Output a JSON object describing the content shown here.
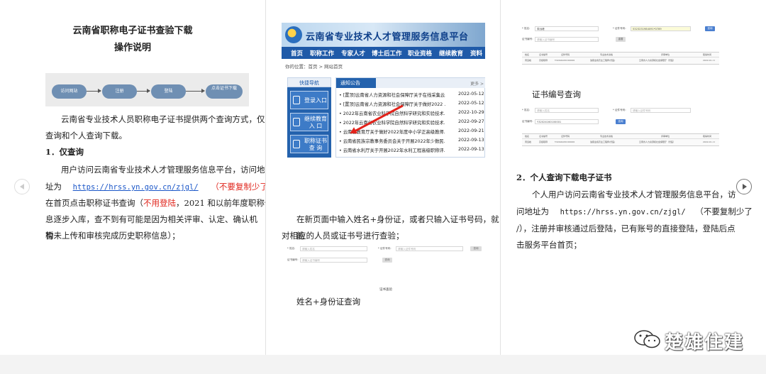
{
  "page1": {
    "title": "云南省职称电子证书查验下载",
    "subtitle": "操作说明",
    "flow": [
      "访问网站",
      "注册",
      "登陆",
      "点击证书下载"
    ],
    "intro_l1": "云南省专业技术人员职称电子证书提供两个查询方式，仅",
    "intro_l2": "查询和个人查询下载。",
    "h1": "1．仅查询",
    "p1_l1": "用户访问云南省专业技术人才管理服务信息平台，访问地",
    "p1_l2_prefix": "址为",
    "p1_url": "https://hrss.yn.gov.cn/zjgl/",
    "p1_l2_red": "（不要复制少了/），",
    "p1_l3_a": "在首页点击职称证书查询（",
    "p1_l3_red": "不用登陆",
    "p1_l3_b": "，2021 和以前年度职称信",
    "p1_l4": "息逐步入库，查不到有可能是因为相关评审、认定、确认机构",
    "p1_l5": "暂未上传和审核完成历史职称信息）；"
  },
  "page2": {
    "portal": {
      "title": "云南省专业技术人才管理服务信息平台",
      "nav": [
        "首页",
        "职称工作",
        "专家人才",
        "博士后工作",
        "职业资格",
        "继续教育",
        "资料下"
      ],
      "crumb": "你的位置：首页 > 网站首页",
      "quick_head": "快捷导航",
      "quick": [
        "登录入口",
        "继续教育入 口",
        "职称证书查 询"
      ],
      "notice_tab": "通知公告",
      "more": "更多 >",
      "notices": [
        {
          "t": "• [置顶]云南省人力资源和社会保障厅关于在线采集云...",
          "d": "2022-05-12"
        },
        {
          "t": "• [置顶]云南省人力资源和社会保障厅关于做好2022 ...",
          "d": "2022-05-12"
        },
        {
          "t": "• 2022年云南省农业科学院自然科学研究和实验技术...",
          "d": "2022-10-29"
        },
        {
          "t": "• 2022年云南省农业科学院自然科学研究和实验技术...",
          "d": "2022-09-27"
        },
        {
          "t": "• 云南省教育厅关于做好2022年度中小学正高级教师...",
          "d": "2022-09-21"
        },
        {
          "t": "• 云南省民族宗教事务委员会关于开展2022年少数民...",
          "d": "2022-09-13"
        },
        {
          "t": "• 云南省水利厅关于开展2022年水利工程高级职称评...",
          "d": "2022-09-13"
        }
      ]
    },
    "para_l1": "在新页面中输入姓名+身份证，或者只输入证书号码，就能",
    "para_l2": "对相应的人员或证书号进行查验；",
    "form": {
      "name_label": "* 姓名:",
      "name_ph": "请输入姓名",
      "cert_label": "* 证件号码:",
      "cert_ph": "请输入证件号码",
      "certno_label": "证书编号:",
      "certno_ph": "请输入证书编号",
      "btn": "查询",
      "caption": "证书查验"
    },
    "bottom": "姓名+身份证查询"
  },
  "page3": {
    "form_a": {
      "name_label": "* 姓名:",
      "name_val": "周远峰",
      "cert_label": "* 证件号码:",
      "cert_val": "5323231984091*0789",
      "certno_label": "证书编号:",
      "certno_ph": "请输入证书编号",
      "btn": "查询",
      "btn2": "重置"
    },
    "table_head": [
      "姓名",
      "证书编号",
      "证件号码",
      "专业技术资格",
      "评审单位",
      "取得时间"
    ],
    "table_row": [
      "周远峰",
      "高级职称",
      "Y32024160100001",
      "渔猎业和农业工程师(兽医)",
      "云南省人力资源和社会保障厅（兽医）",
      "2022-01-11"
    ],
    "cert_heading": "证书编号查询",
    "form_b": {
      "certno_val": "Y32024160100001",
      "btn": "查询"
    },
    "h2": "2．个人查询下载电子证书",
    "p_l1": "个人用户访问云南省专业技术人才管理服务信息平台，访",
    "p_l2_prefix": "问地址为",
    "p_url": "https://hrss.yn.gov.cn/zjgl/",
    "p_l2_suffix": "（不要复制少了",
    "p_l3": "/），注册并审核通过后登陆，已有账号的直接登陆，登陆后点",
    "p_l4": "击服务平台首页；"
  },
  "watermark": "楚雄住建",
  "colors": {
    "link": "#1a56c8",
    "red": "#e0261d",
    "portal_blue": "#1f5aa8",
    "flow_node": "#6f8fb3"
  }
}
